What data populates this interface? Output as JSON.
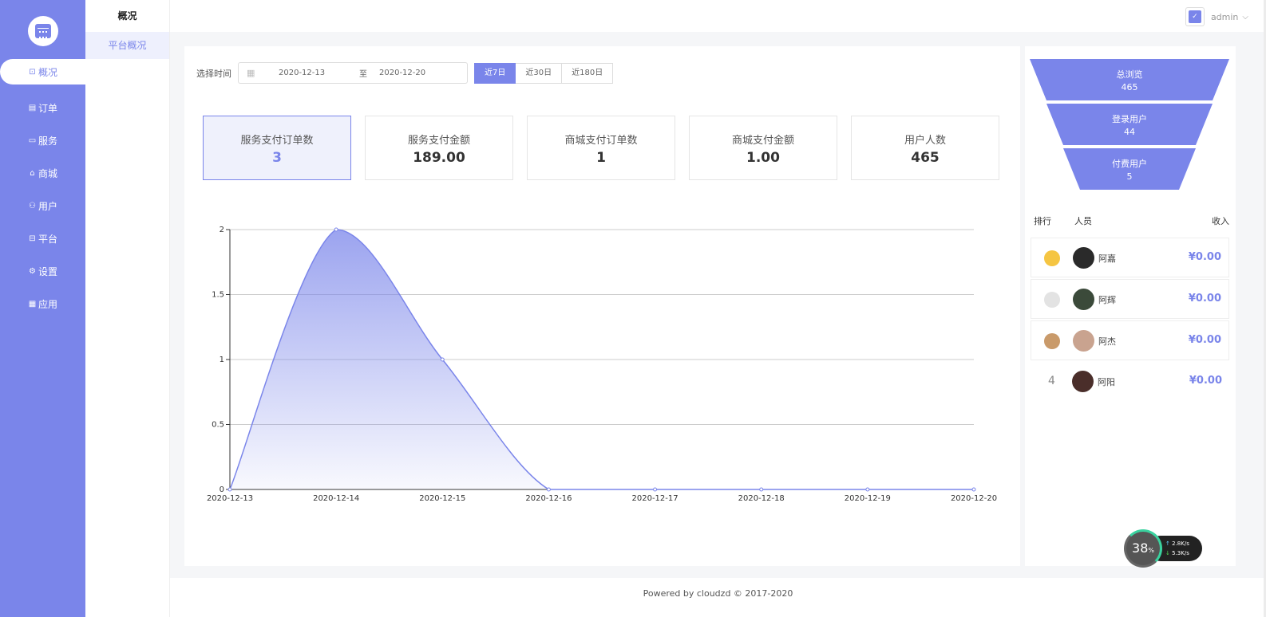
{
  "sidebar": {
    "items": [
      {
        "icon": "overview-icon",
        "glyph": "⊡",
        "label": "概况",
        "active": true
      },
      {
        "icon": "order-icon",
        "glyph": "▤",
        "label": "订单"
      },
      {
        "icon": "service-icon",
        "glyph": "▭",
        "label": "服务"
      },
      {
        "icon": "mall-icon",
        "glyph": "⌂",
        "label": "商城"
      },
      {
        "icon": "user-icon",
        "glyph": "⚇",
        "label": "用户"
      },
      {
        "icon": "platform-icon",
        "glyph": "⊟",
        "label": "平台"
      },
      {
        "icon": "settings-icon",
        "glyph": "⚙",
        "label": "设置"
      },
      {
        "icon": "apps-icon",
        "glyph": "▦",
        "label": "应用"
      }
    ]
  },
  "subnav": {
    "title": "概况",
    "items": [
      "平台概况"
    ]
  },
  "topbar": {
    "user": "admin",
    "caret": "⌵"
  },
  "filter": {
    "label": "选择时间",
    "start": "2020-12-13",
    "separator": "至",
    "end": "2020-12-20",
    "tabs": [
      "近7日",
      "近30日",
      "近180日"
    ]
  },
  "stats": [
    {
      "label": "服务支付订单数",
      "value": "3"
    },
    {
      "label": "服务支付金额",
      "value": "189.00"
    },
    {
      "label": "商城支付订单数",
      "value": "1"
    },
    {
      "label": "商城支付金额",
      "value": "1.00"
    },
    {
      "label": "用户人数",
      "value": "465"
    }
  ],
  "chart_data": {
    "type": "area",
    "x": [
      "2020-12-13",
      "2020-12-14",
      "2020-12-15",
      "2020-12-16",
      "2020-12-17",
      "2020-12-18",
      "2020-12-19",
      "2020-12-20"
    ],
    "x_tick_labels": [
      "2020-12-13",
      "2020-12-14",
      "2020-12-15",
      "2020-12-16",
      "2020-12-17",
      "2020-12-18",
      "2020-12-19",
      "2020-12-20"
    ],
    "series": [
      {
        "values": [
          0,
          2,
          1,
          0,
          0,
          0,
          0,
          0
        ]
      }
    ],
    "ylim": [
      0,
      2
    ],
    "yticks": [
      0,
      0.5,
      1,
      1.5,
      2
    ],
    "ytick_labels": [
      "0",
      "0.5",
      "1",
      "1.5",
      "2"
    ],
    "grid": true,
    "color": "#7a85ea",
    "smooth": true
  },
  "funnel": [
    {
      "label": "总浏览",
      "value": "465"
    },
    {
      "label": "登录用户",
      "value": "44"
    },
    {
      "label": "付费用户",
      "value": "5"
    }
  ],
  "ranking": {
    "headers": {
      "rank": "排行",
      "person": "人员",
      "income": "收入"
    },
    "rows": [
      {
        "rank": "1",
        "medal": "gold",
        "name": "阿嘉",
        "income": "¥0.00",
        "avatar_color": "#2a2a2a"
      },
      {
        "rank": "2",
        "medal": "silver",
        "name": "阿辉",
        "income": "¥0.00",
        "avatar_color": "#3b4a3a"
      },
      {
        "rank": "3",
        "medal": "bronze",
        "name": "阿杰",
        "income": "¥0.00",
        "avatar_color": "#c9a38f"
      },
      {
        "rank": "4",
        "medal": "",
        "name": "阿阳",
        "income": "¥0.00",
        "avatar_color": "#4a2e2a"
      }
    ]
  },
  "speed_widget": {
    "percent": "38",
    "unit": "%",
    "up": "2.8K/s",
    "down": "5.3K/s"
  },
  "footer": {
    "text": "Powered by cloudzd © 2017-2020"
  },
  "colors": {
    "accent": "#7a85ea"
  }
}
